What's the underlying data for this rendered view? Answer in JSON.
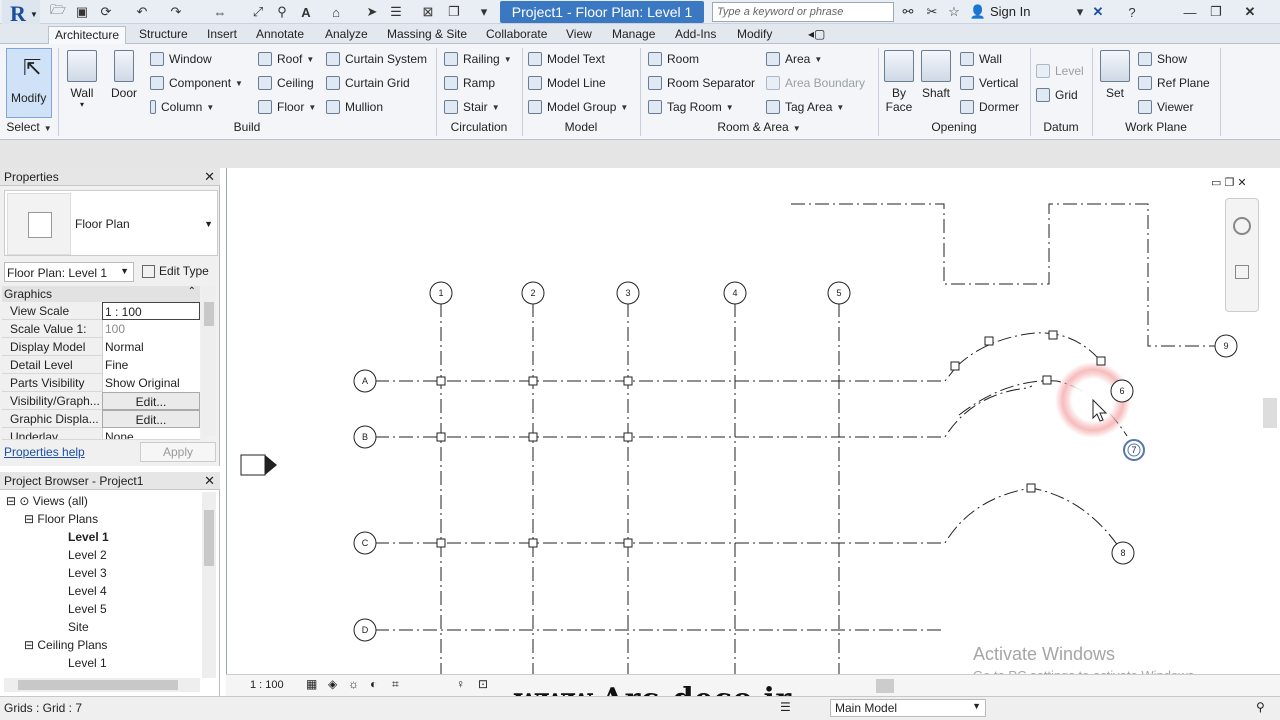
{
  "titlebar": {
    "app_letter": "R",
    "project_title": "Project1 - Floor Plan: Level 1",
    "search_placeholder": "Type a keyword or phrase",
    "signin": "Sign In"
  },
  "tabs": [
    "Architecture",
    "Structure",
    "Insert",
    "Annotate",
    "Analyze",
    "Massing & Site",
    "Collaborate",
    "View",
    "Manage",
    "Add-Ins",
    "Modify"
  ],
  "active_tab": "Architecture",
  "ribbon": {
    "modify": "Modify",
    "select": "Select",
    "wall": "Wall",
    "door": "Door",
    "window": "Window",
    "component": "Component",
    "column": "Column",
    "roof": "Roof",
    "ceiling": "Ceiling",
    "floor": "Floor",
    "curtain_system": "Curtain System",
    "curtain_grid": "Curtain Grid",
    "mullion": "Mullion",
    "railing": "Railing",
    "ramp": "Ramp",
    "stair": "Stair",
    "model_text": "Model Text",
    "model_line": "Model Line",
    "model_group": "Model Group",
    "room": "Room",
    "room_separator": "Room Separator",
    "tag_room": "Tag Room",
    "area": "Area",
    "area_boundary": "Area Boundary",
    "tag_area": "Tag Area",
    "by_face": "By Face",
    "shaft": "Shaft",
    "wall_opening": "Wall",
    "vertical": "Vertical",
    "dormer": "Dormer",
    "level": "Level",
    "grid": "Grid",
    "set": "Set",
    "show": "Show",
    "ref_plane": "Ref Plane",
    "viewer": "Viewer",
    "groups": {
      "build": "Build",
      "circulation": "Circulation",
      "model": "Model",
      "room_area": "Room & Area",
      "opening": "Opening",
      "datum": "Datum",
      "work_plane": "Work Plane"
    }
  },
  "properties": {
    "title": "Properties",
    "type_name": "Floor Plan",
    "instance": "Floor Plan: Level 1",
    "edit_type": "Edit Type",
    "section": "Graphics",
    "rows": [
      {
        "k": "View Scale",
        "v": "1 : 100"
      },
      {
        "k": "Scale Value    1:",
        "v": "100"
      },
      {
        "k": "Display Model",
        "v": "Normal"
      },
      {
        "k": "Detail Level",
        "v": "Fine"
      },
      {
        "k": "Parts Visibility",
        "v": "Show Original"
      },
      {
        "k": "Visibility/Graph...",
        "v": "Edit..."
      },
      {
        "k": "Graphic Displa...",
        "v": "Edit..."
      },
      {
        "k": "Underlay",
        "v": "None"
      }
    ],
    "help": "Properties help",
    "apply": "Apply"
  },
  "browser": {
    "title": "Project Browser - Project1",
    "items": [
      {
        "label": "Views (all)",
        "indent": 0
      },
      {
        "label": "Floor Plans",
        "indent": 1
      },
      {
        "label": "Level 1",
        "indent": 2
      },
      {
        "label": "Level 2",
        "indent": 2
      },
      {
        "label": "Level 3",
        "indent": 2
      },
      {
        "label": "Level 4",
        "indent": 2
      },
      {
        "label": "Level 5",
        "indent": 2
      },
      {
        "label": "Site",
        "indent": 2
      },
      {
        "label": "Ceiling Plans",
        "indent": 1
      },
      {
        "label": "Level 1",
        "indent": 2
      }
    ]
  },
  "canvas": {
    "grid_columns": [
      "1",
      "2",
      "3",
      "4",
      "5"
    ],
    "grid_rows": [
      "A",
      "B",
      "C",
      "D"
    ],
    "extra_grids": [
      "6",
      "7",
      "8",
      "9"
    ],
    "watermark_title": "Activate Windows",
    "watermark_sub": "Go to PC settings to activate Windows.",
    "site_text": "www.Arc-deco.ir"
  },
  "viewbar": {
    "scale": "1 : 100"
  },
  "status": {
    "left": "Grids : Grid : 7",
    "model": "Main Model"
  }
}
